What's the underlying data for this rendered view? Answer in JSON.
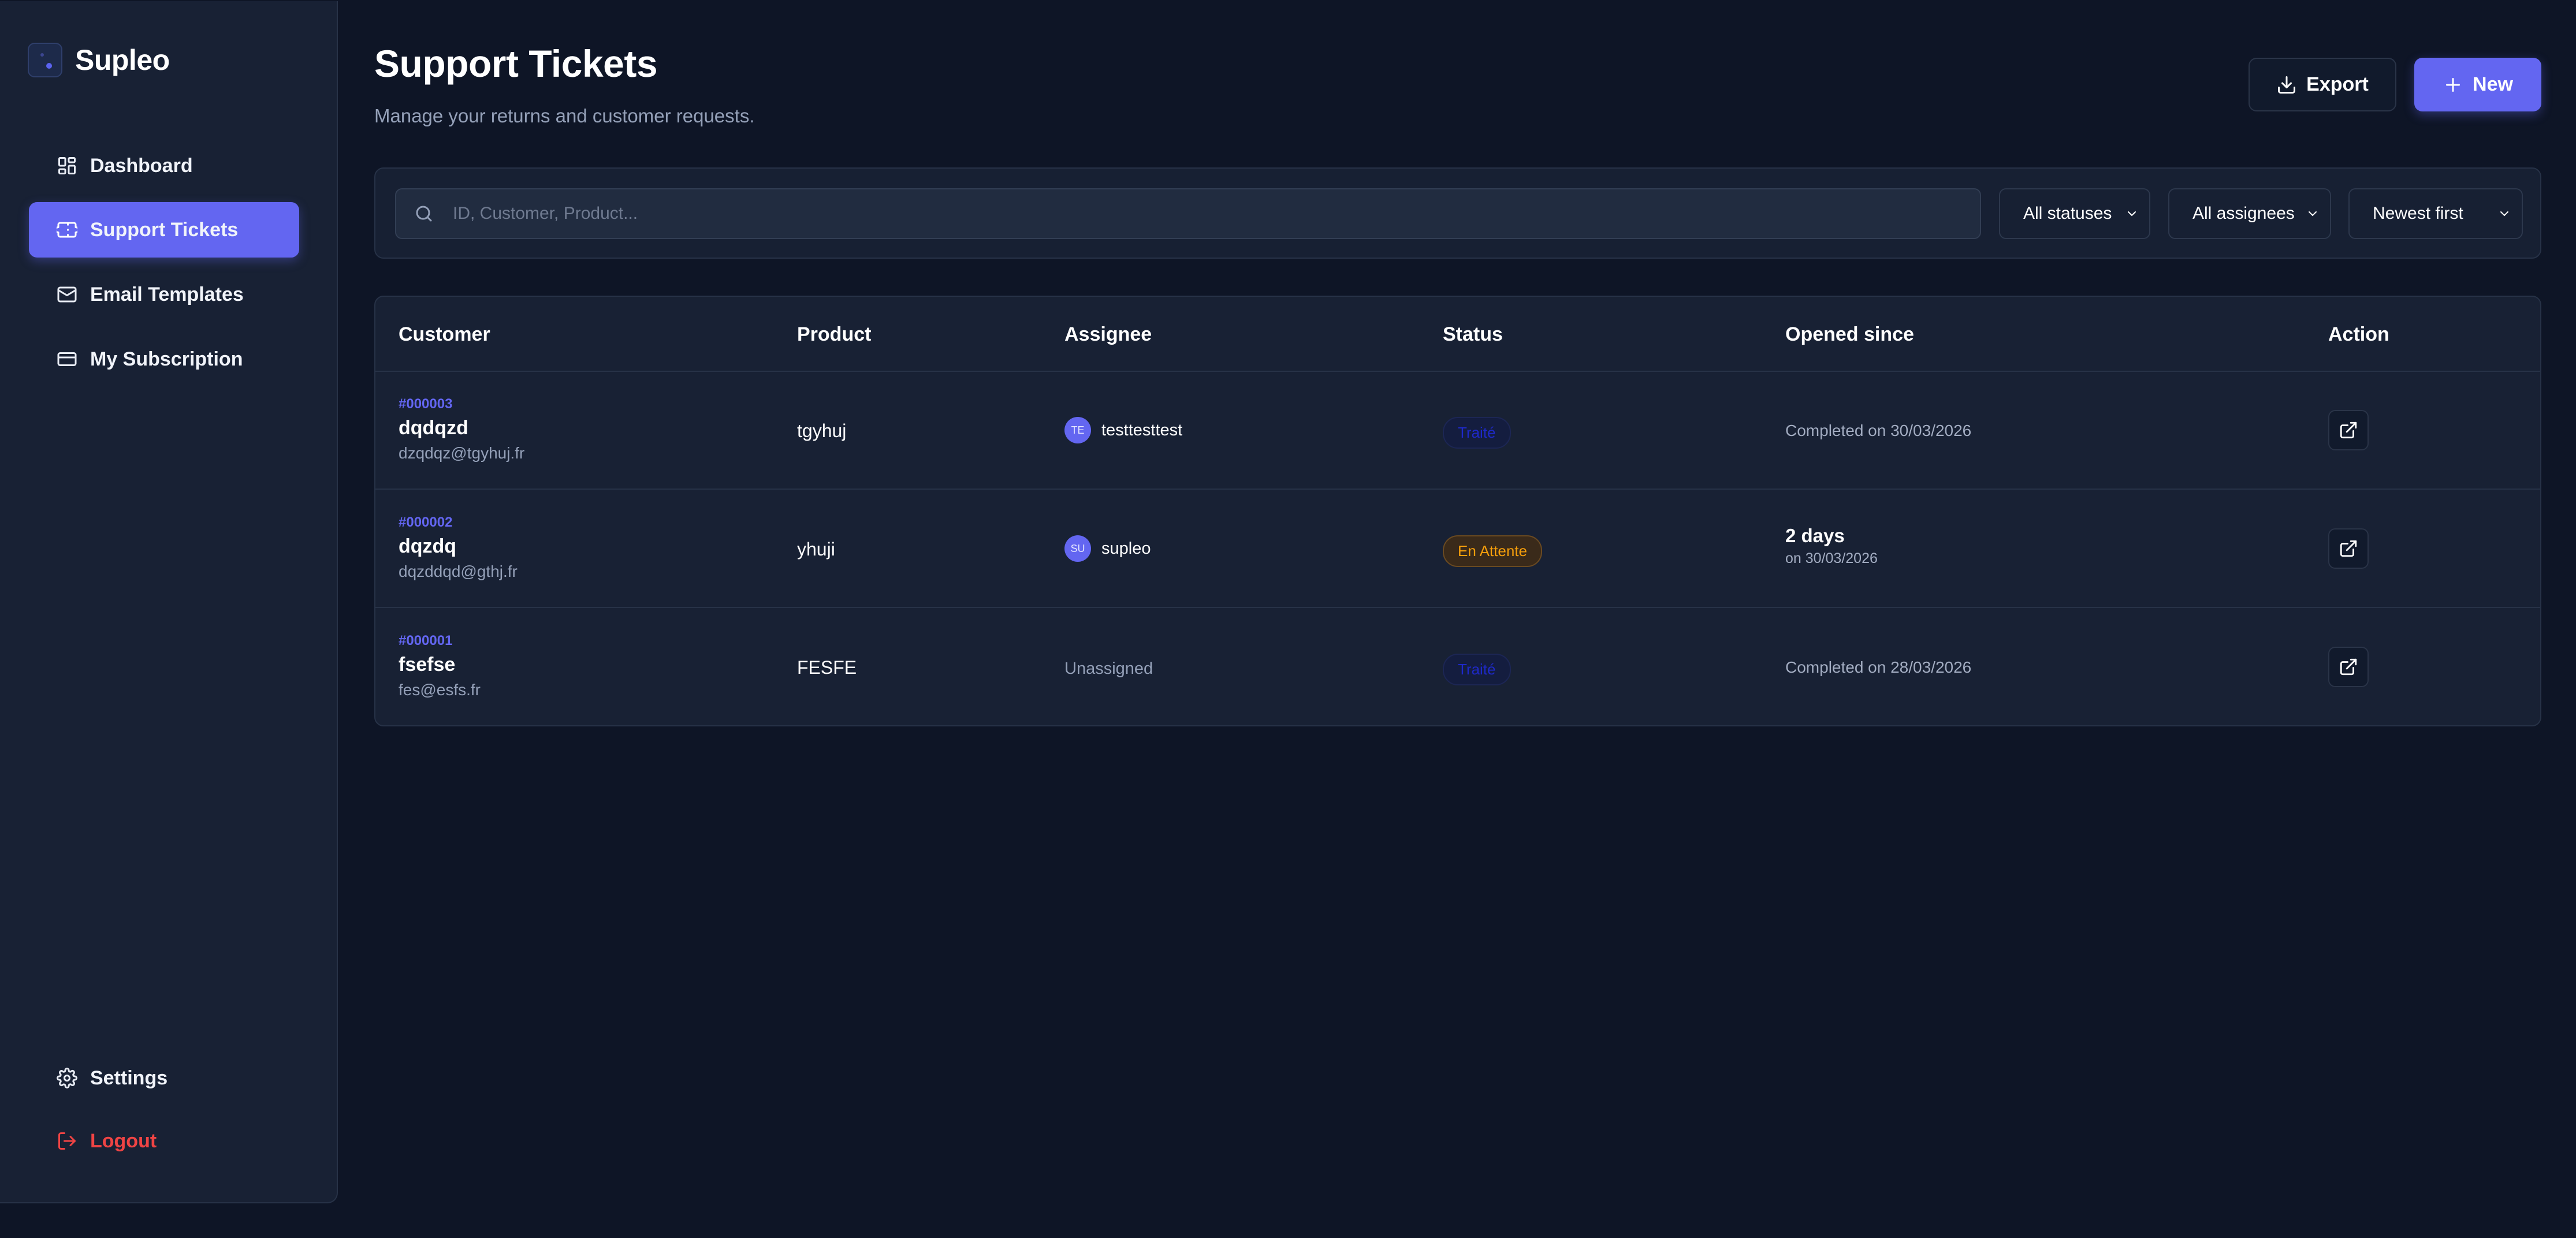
{
  "app": {
    "name": "Supleo"
  },
  "sidebar": {
    "items": [
      {
        "label": "Dashboard",
        "icon": "dashboard-icon"
      },
      {
        "label": "Support Tickets",
        "icon": "ticket-icon",
        "active": true
      },
      {
        "label": "Email Templates",
        "icon": "mail-icon"
      },
      {
        "label": "My Subscription",
        "icon": "credit-card-icon"
      }
    ],
    "settings_label": "Settings",
    "logout_label": "Logout"
  },
  "header": {
    "title": "Support Tickets",
    "subtitle": "Manage your returns and customer requests.",
    "export_label": "Export",
    "new_label": "New"
  },
  "filters": {
    "search_placeholder": "ID, Customer, Product...",
    "status": "All statuses",
    "assignee": "All assignees",
    "sort": "Newest first"
  },
  "table": {
    "columns": [
      "Customer",
      "Product",
      "Assignee",
      "Status",
      "Opened since",
      "Action"
    ],
    "rows": [
      {
        "id": "#000003",
        "name": "dqdqzd",
        "email": "dzqdqz@tgyhuj.fr",
        "product": "tgyhuj",
        "assignee_initials": "TE",
        "assignee": "testtesttest",
        "status": "Traité",
        "opened": "Completed on 30/03/2026"
      },
      {
        "id": "#000002",
        "name": "dqzdq",
        "email": "dqzddqd@gthj.fr",
        "product": "yhuji",
        "assignee_initials": "SU",
        "assignee": "supleo",
        "status": "En Attente",
        "opened_main": "2 days",
        "opened_sub": "on 30/03/2026"
      },
      {
        "id": "#000001",
        "name": "fsefse",
        "email": "fes@esfs.fr",
        "product": "FESFE",
        "assignee": "Unassigned",
        "status": "Traité",
        "opened": "Completed on 28/03/2026"
      }
    ]
  },
  "colors": {
    "background": "#0e1526",
    "sidebar": "#182134",
    "accent": "#6366f1",
    "logout": "#ef4444",
    "pending": "#f59e0b"
  }
}
